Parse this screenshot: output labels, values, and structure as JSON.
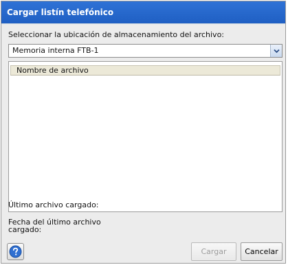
{
  "window": {
    "title": "Cargar listín telefónico"
  },
  "location": {
    "label": "Seleccionar la ubicación de almacenamiento del archivo:",
    "selected": "Memoria interna FTB-1"
  },
  "file_list": {
    "columns": [
      "Nombre de archivo"
    ],
    "rows": []
  },
  "info": {
    "last_file_label": "Último archivo cargado:",
    "last_file_value": "",
    "last_date_label_line1": "Fecha del último archivo",
    "last_date_label_line2": "cargado:",
    "last_date_value": ""
  },
  "buttons": {
    "load": "Cargar",
    "cancel": "Cancelar"
  },
  "icons": {
    "help": "help-icon",
    "dropdown": "chevron-down-icon"
  },
  "colors": {
    "title_bar": "#2666cc",
    "help_icon": "#2f6fd1"
  }
}
